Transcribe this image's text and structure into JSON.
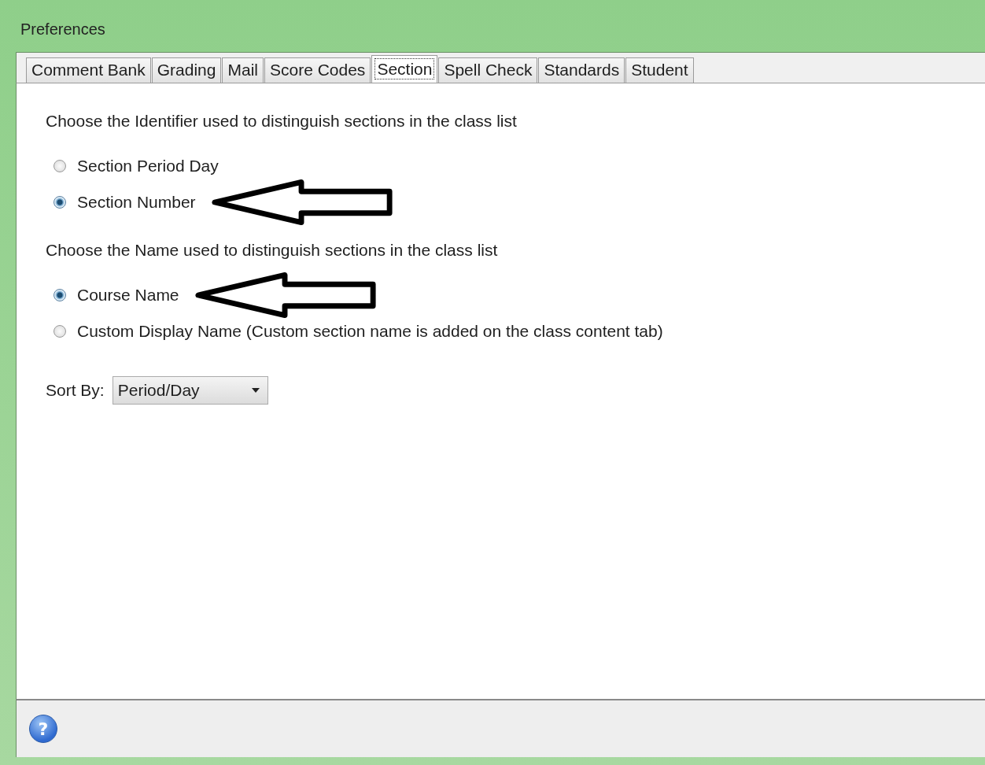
{
  "window": {
    "title": "Preferences"
  },
  "tabs": [
    {
      "label": "Comment Bank",
      "selected": false
    },
    {
      "label": "Grading",
      "selected": false
    },
    {
      "label": "Mail",
      "selected": false
    },
    {
      "label": "Score Codes",
      "selected": false
    },
    {
      "label": "Section",
      "selected": true
    },
    {
      "label": "Spell Check",
      "selected": false
    },
    {
      "label": "Standards",
      "selected": false
    },
    {
      "label": "Student",
      "selected": false
    }
  ],
  "groups": [
    {
      "prompt": "Choose the Identifier used to distinguish sections in the class list",
      "options": [
        {
          "label": "Section Period Day",
          "selected": false,
          "arrow": false
        },
        {
          "label": "Section Number",
          "selected": true,
          "arrow": true
        }
      ]
    },
    {
      "prompt": "Choose the Name used to distinguish sections in the class list",
      "options": [
        {
          "label": "Course Name",
          "selected": true,
          "arrow": true
        },
        {
          "label": "Custom Display Name (Custom section name is added on the class content tab)",
          "selected": false,
          "arrow": false
        }
      ]
    }
  ],
  "sort_by": {
    "label": "Sort By:",
    "value": "Period/Day"
  },
  "help_button": {
    "label": "?"
  }
}
